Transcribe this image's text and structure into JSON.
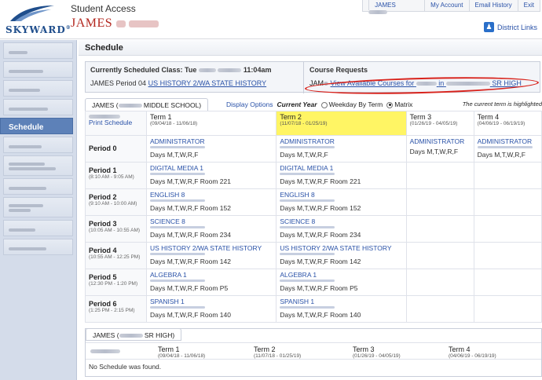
{
  "app": {
    "title": "Student Access",
    "logo_text": "SKYWARD",
    "logo_mark": "®"
  },
  "user": {
    "first_name": "JAMES"
  },
  "topnav": {
    "user": "JAMES",
    "items": [
      "My Account",
      "Email History",
      "Exit"
    ]
  },
  "district_links": "District Links",
  "sidebar": {
    "active": "Schedule"
  },
  "page_title": "Schedule",
  "current_class": {
    "label": "Currently Scheduled Class: Tue",
    "time": "11:04am",
    "line2_prefix": "JAMES",
    "period": "Period 04",
    "course": "US HISTORY 2/WA STATE HISTORY"
  },
  "course_requests": {
    "label": "Course Requests",
    "prefix": "JAM",
    "link_a": "View Available Courses for",
    "link_b": "in",
    "link_c": "SR HIGH"
  },
  "schedule1": {
    "student": "JAMES",
    "school": "MIDDLE SCHOOL)",
    "display_options": "Display Options",
    "current_year": "Current Year",
    "opt_weekday": "Weekday By Term",
    "opt_matrix": "Matrix",
    "note": "The current term is highlighted",
    "print": "Print Schedule",
    "terms": [
      {
        "name": "Term 1",
        "dates": "(09/04/18 - 11/06/18)"
      },
      {
        "name": "Term 2",
        "dates": "(11/07/18 - 01/25/19)"
      },
      {
        "name": "Term 3",
        "dates": "(01/26/19 - 04/05/19)"
      },
      {
        "name": "Term 4",
        "dates": "(04/06/19 - 06/19/19)"
      }
    ],
    "periods": [
      {
        "name": "Period 0",
        "time": "",
        "t1": {
          "course": "ADMINISTRATOR",
          "days": "Days M,T,W,R,F"
        },
        "t2": {
          "course": "ADMINISTRATOR",
          "days": "Days M,T,W,R,F"
        },
        "t3": {
          "course": "ADMINISTRATOR",
          "days": "Days M,T,W,R,F"
        },
        "t4": {
          "course": "ADMINISTRATOR",
          "days": "Days M,T,W,R,F"
        }
      },
      {
        "name": "Period 1",
        "time": "(8:10 AM - 9:05 AM)",
        "t1": {
          "course": "DIGITAL MEDIA 1",
          "days": "Days M,T,W,R,F   Room 221"
        },
        "t2": {
          "course": "DIGITAL MEDIA 1",
          "days": "Days M,T,W,R,F   Room 221"
        }
      },
      {
        "name": "Period 2",
        "time": "(9:10 AM - 10:00 AM)",
        "t1": {
          "course": "ENGLISH 8",
          "days": "Days M,T,W,R,F   Room 152"
        },
        "t2": {
          "course": "ENGLISH 8",
          "days": "Days M,T,W,R,F   Room 152"
        }
      },
      {
        "name": "Period 3",
        "time": "(10:05 AM - 10:55 AM)",
        "t1": {
          "course": "SCIENCE 8",
          "days": "Days M,T,W,R,F   Room 234"
        },
        "t2": {
          "course": "SCIENCE 8",
          "days": "Days M,T,W,R,F   Room 234"
        }
      },
      {
        "name": "Period 4",
        "time": "(10:55 AM - 12:25 PM)",
        "t1": {
          "course": "US HISTORY 2/WA STATE HISTORY",
          "days": "Days M,T,W,R,F   Room 142"
        },
        "t2": {
          "course": "US HISTORY 2/WA STATE HISTORY",
          "days": "Days M,T,W,R,F   Room 142"
        }
      },
      {
        "name": "Period 5",
        "time": "(12:30 PM - 1:20 PM)",
        "t1": {
          "course": "ALGEBRA 1",
          "days": "Days M,T,W,R,F   Room P5"
        },
        "t2": {
          "course": "ALGEBRA 1",
          "days": "Days M,T,W,R,F   Room P5"
        }
      },
      {
        "name": "Period 6",
        "time": "(1:25 PM - 2:15 PM)",
        "t1": {
          "course": "SPANISH 1",
          "days": "Days M,T,W,R,F   Room 140"
        },
        "t2": {
          "course": "SPANISH 1",
          "days": "Days M,T,W,R,F   Room 140"
        }
      }
    ]
  },
  "schedule2": {
    "student": "JAMES",
    "school": "SR HIGH)",
    "terms": [
      {
        "name": "Term 1",
        "dates": "(09/04/18 - 11/06/18)"
      },
      {
        "name": "Term 2",
        "dates": "(11/07/18 - 01/25/19)"
      },
      {
        "name": "Term 3",
        "dates": "(01/26/19 - 04/05/19)"
      },
      {
        "name": "Term 4",
        "dates": "(04/06/19 - 06/19/19)"
      }
    ],
    "empty": "No Schedule was found."
  },
  "colors": {
    "brand_blue": "#2a52a8",
    "name_red": "#b3261e",
    "highlight_yellow": "#fff564",
    "annotation_red": "#d8231c"
  }
}
